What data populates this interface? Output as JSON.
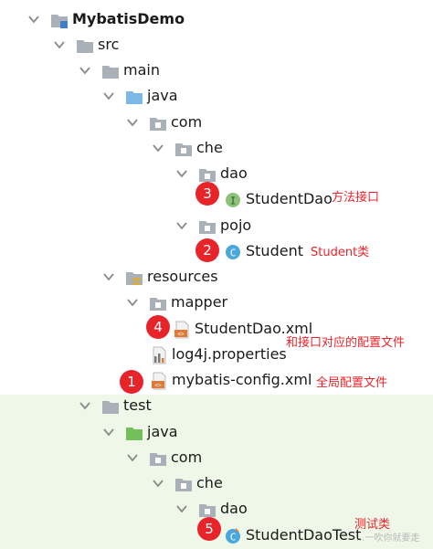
{
  "project": {
    "name": "MybatisDemo"
  },
  "nodes": {
    "src": "src",
    "main": "main",
    "java": "java",
    "com": "com",
    "che": "che",
    "dao": "dao",
    "student_dao": "StudentDao",
    "pojo": "pojo",
    "student": "Student",
    "resources": "resources",
    "mapper": "mapper",
    "student_dao_xml": "StudentDao.xml",
    "log4j": "log4j.properties",
    "mybatis_config": "mybatis-config.xml",
    "test": "test",
    "test_java": "java",
    "test_com": "com",
    "test_che": "che",
    "test_dao": "dao",
    "student_dao_test": "StudentDaoTest"
  },
  "badges": {
    "b1": "1",
    "b2": "2",
    "b3": "3",
    "b4": "4",
    "b5": "5"
  },
  "annotations": {
    "interface": "方法接口",
    "student_class": "Student类",
    "mapper_config": "和接口对应的配置文件",
    "global_config": "全局配置文件",
    "test_class": "测试类"
  },
  "watermark": "...一吹你就要走",
  "colors": {
    "folder": "#a9b0b8",
    "source_folder": "#7cb8e6",
    "test_folder": "#73c05a",
    "interface_icon": "#8fc17b",
    "class_icon": "#49a7db",
    "badge": "#e8242b",
    "test_background": "#eff7e8"
  }
}
